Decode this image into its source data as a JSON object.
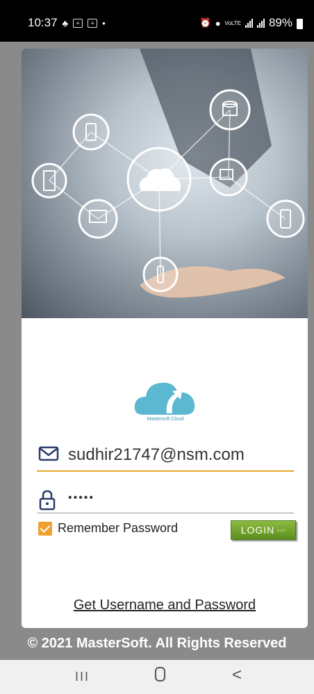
{
  "status_bar": {
    "time": "10:37",
    "battery": "89%",
    "network": "VoLTE"
  },
  "login": {
    "email_value": "sudhir21747@nsm.com",
    "password_value": "•••••",
    "remember_label": "Remember Password",
    "remember_checked": true,
    "login_button": "LOGIN",
    "get_credentials_link": "Get Username and Password",
    "logo_caption": "Mastersoft Cloud"
  },
  "footer": {
    "copyright": "© 2021 MasterSoft. All Rights Reserved"
  },
  "nav": {
    "recent": "III",
    "back": "<"
  },
  "colors": {
    "accent_orange": "#e3a528",
    "login_green": "#6a9a28",
    "logo_blue": "#5cb8d0",
    "background_gray": "#8a8a8a"
  }
}
